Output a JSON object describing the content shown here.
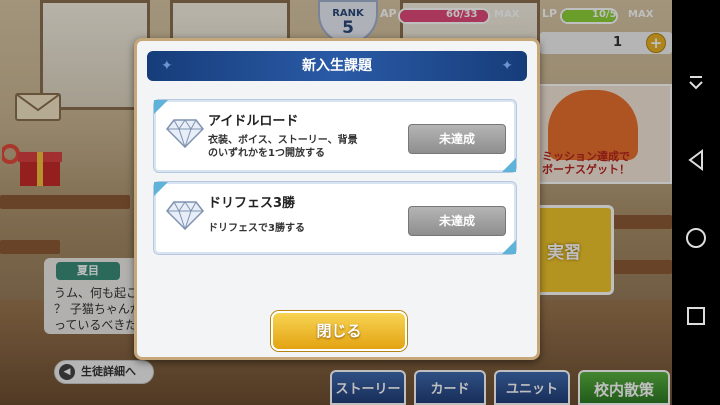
{
  "status": {
    "rank_label": "RANK",
    "rank_value": "5",
    "ap_label": "AP",
    "ap_value": "60/33",
    "ap_max": "MAX",
    "ap_fill": 1.0,
    "lp_label": "LP",
    "lp_value": "10/5",
    "lp_max": "MAX",
    "lp_fill": 1.0,
    "currency_count": "1",
    "plus_label": "+"
  },
  "colors": {
    "ap_fill": "#e24a7a",
    "lp_fill": "#8fd23a",
    "header_blue": "#1f4f96",
    "close_gold": "#f0bd2e",
    "status_gray": "#9a9a9a"
  },
  "promo": {
    "line1": "ミッション達成で",
    "line2": "ボーナスゲット！"
  },
  "produce_label": "実習",
  "character": {
    "name": "夏目",
    "lines": [
      "うム、何も起こらないのも退屈だネ",
      "？ 子猫ちゃんが戻ってくるまで待",
      "っているべきだろうカ？"
    ]
  },
  "student_detail_label": "生徒詳細へ",
  "nav": {
    "story": "ストーリー",
    "card": "カード",
    "unit": "ユニット",
    "walk": "校内散策"
  },
  "dialog": {
    "title": "新入生課題",
    "tasks": [
      {
        "title": "アイドルロード",
        "desc_line1": "衣装、ボイス、ストーリー、背景",
        "desc_line2": "のいずれかを1つ開放する",
        "status": "未達成"
      },
      {
        "title": "ドリフェス3勝",
        "desc_line1": "ドリフェスで3勝する",
        "status": "未達成"
      }
    ],
    "close_label": "閉じる"
  },
  "icons": [
    "mail-icon",
    "gift-icon",
    "diamond-icon",
    "back-arrow-icon",
    "android-menu-icon",
    "android-back-icon",
    "android-home-icon",
    "android-recents-icon"
  ]
}
